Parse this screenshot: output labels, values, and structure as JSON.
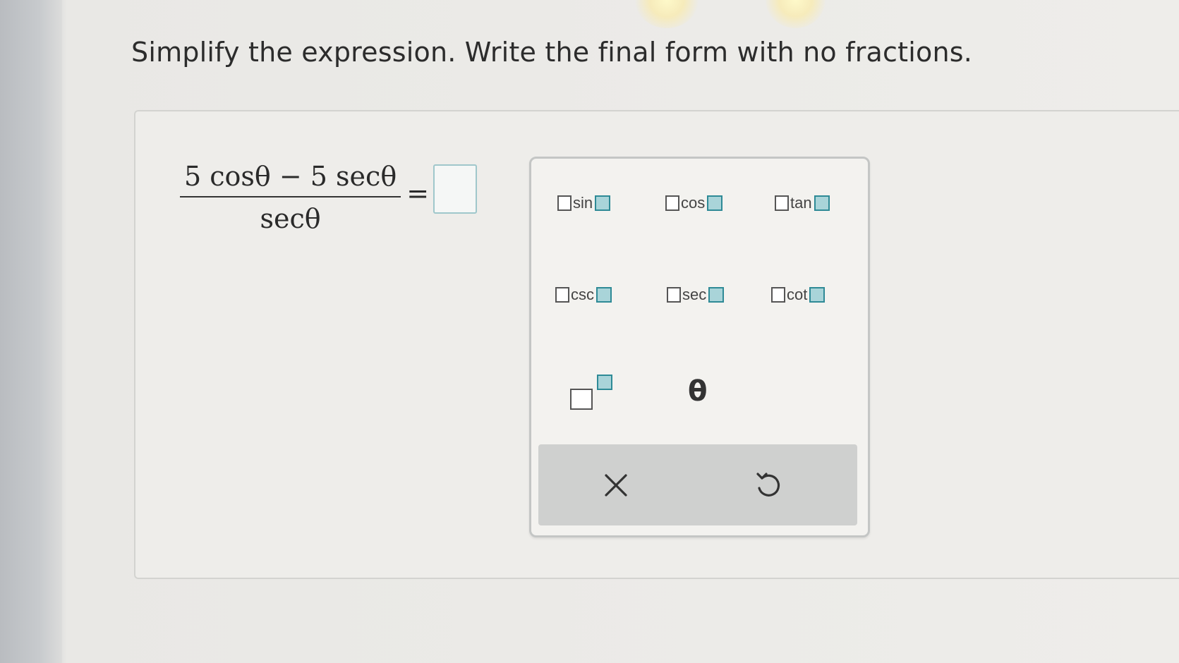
{
  "prompt": "Simplify the expression. Write the final form with no fractions.",
  "expression": {
    "numerator": "5 cosθ − 5 secθ",
    "denominator": "secθ",
    "equals": "="
  },
  "answer": {
    "value": ""
  },
  "palette": {
    "functions": [
      {
        "label": "sin"
      },
      {
        "label": "cos"
      },
      {
        "label": "tan"
      },
      {
        "label": "csc"
      },
      {
        "label": "sec"
      },
      {
        "label": "cot"
      }
    ],
    "theta_label": "θ",
    "icons": {
      "exponent": "exponent-template-icon",
      "clear": "clear-x-icon",
      "undo": "undo-icon"
    }
  }
}
